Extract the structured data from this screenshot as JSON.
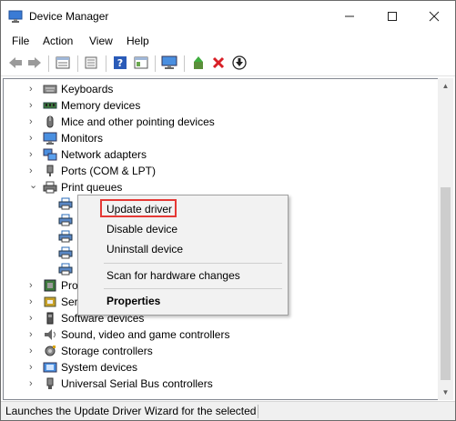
{
  "window": {
    "title": "Device Manager"
  },
  "menu": [
    "File",
    "Action",
    "View",
    "Help"
  ],
  "toolbar": [
    "back-icon",
    "forward-icon",
    "properties-view-icon",
    "show-hidden-icon",
    "help-icon",
    "console-tree-icon",
    "monitor-icon",
    "update-driver-icon",
    "uninstall-icon",
    "download-icon"
  ],
  "tree": {
    "categories": [
      {
        "label": "Keyboards",
        "icon": "keyboard-icon"
      },
      {
        "label": "Memory devices",
        "icon": "memory-icon"
      },
      {
        "label": "Mice and other pointing devices",
        "icon": "mouse-icon"
      },
      {
        "label": "Monitors",
        "icon": "monitor-icon"
      },
      {
        "label": "Network adapters",
        "icon": "network-adapter-icon"
      },
      {
        "label": "Ports (COM & LPT)",
        "icon": "port-icon"
      },
      {
        "label": "Print queues",
        "icon": "printer-icon"
      }
    ],
    "partial": [
      {
        "label": "Pro",
        "icon": "processor-icon"
      },
      {
        "label": "Ser",
        "icon": "security-device-icon"
      }
    ],
    "lower": [
      {
        "label": "Software devices",
        "icon": "software-device-icon"
      },
      {
        "label": "Sound, video and game controllers",
        "icon": "sound-icon"
      },
      {
        "label": "Storage controllers",
        "icon": "storage-icon"
      },
      {
        "label": "System devices",
        "icon": "system-device-icon"
      },
      {
        "label": "Universal Serial Bus controllers",
        "icon": "usb-icon"
      }
    ]
  },
  "context_menu": {
    "update_driver": "Update driver",
    "disable_device": "Disable device",
    "uninstall_device": "Uninstall device",
    "scan_hardware": "Scan for hardware changes",
    "properties": "Properties"
  },
  "status": {
    "text": "Launches the Update Driver Wizard for the selected device."
  },
  "colors": {
    "highlight_border": "#e53935",
    "menu_bg": "#f2f2f2"
  }
}
